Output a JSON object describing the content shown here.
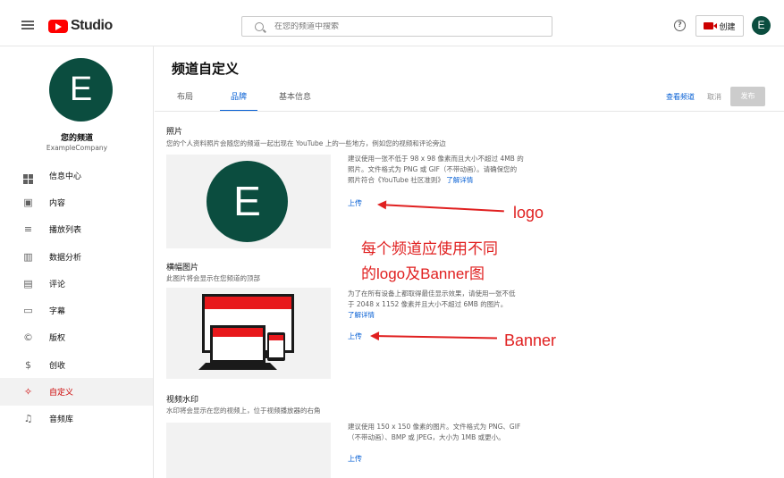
{
  "app": {
    "logo_text": "Studio"
  },
  "search": {
    "placeholder": "在您的频道中搜索"
  },
  "header": {
    "help_glyph": "?",
    "create_label": "创建",
    "avatar_letter": "E"
  },
  "sidebar": {
    "avatar_letter": "E",
    "channel_name": "您的频道",
    "channel_handle": "ExampleCompany",
    "items": [
      {
        "label": "信息中心",
        "icon": "dashboard-icon"
      },
      {
        "label": "内容",
        "icon": "content-icon"
      },
      {
        "label": "播放列表",
        "icon": "playlist-icon"
      },
      {
        "label": "数据分析",
        "icon": "analytics-icon"
      },
      {
        "label": "评论",
        "icon": "comments-icon"
      },
      {
        "label": "字幕",
        "icon": "subtitles-icon"
      },
      {
        "label": "版权",
        "icon": "copyright-icon"
      },
      {
        "label": "创收",
        "icon": "dollar-icon"
      },
      {
        "label": "自定义",
        "icon": "wand-icon",
        "active": true
      },
      {
        "label": "音频库",
        "icon": "audio-library-icon"
      }
    ]
  },
  "main": {
    "title": "频道自定义",
    "tabs": [
      {
        "label": "布局"
      },
      {
        "label": "品牌",
        "active": true
      },
      {
        "label": "基本信息"
      }
    ],
    "actions": {
      "view": "查看频道",
      "cancel": "取消",
      "publish": "发布"
    },
    "photo": {
      "title": "照片",
      "desc": "您的个人资料照片会随您的频道一起出现在 YouTube 上的一些地方，例如您的视频和评论旁边",
      "avatar_letter": "E",
      "info_line1": "建议使用一张不低于 98 x 98 像素而且大小不超过 4MB 的",
      "info_line2": "照片。文件格式为 PNG 或 GIF（不带动画）。请确保您的",
      "info_line3": "照片符合《YouTube 社区准则》",
      "info_link": "了解详情",
      "upload": "上传"
    },
    "banner": {
      "title": "横幅图片",
      "desc": "此图片将会显示在您频道的顶部",
      "info_line1": "为了在所有设备上都取得最佳显示效果，请使用一张不低",
      "info_line2": "于 2048 x 1152 像素并且大小不超过 6MB 的图片。",
      "info_link": "了解详情",
      "upload": "上传"
    },
    "watermark": {
      "title": "视频水印",
      "desc": "水印将会显示在您的视频上，位于视频播放器的右角",
      "info_line1": "建议使用 150 x 150 像素的图片。文件格式为 PNG、GIF",
      "info_line2": "（不带动画）、BMP 或 JPEG，大小为 1MB 或更小。",
      "upload": "上传"
    }
  },
  "annotations": {
    "logo": "logo",
    "line1": "每个频道应使用不同",
    "line2": "的logo及Banner图",
    "banner": "Banner",
    "color": "#e02020"
  },
  "colors": {
    "accent": "#065fd4",
    "brand_red": "#ff0000",
    "avatar_bg": "#0b4d3f"
  }
}
